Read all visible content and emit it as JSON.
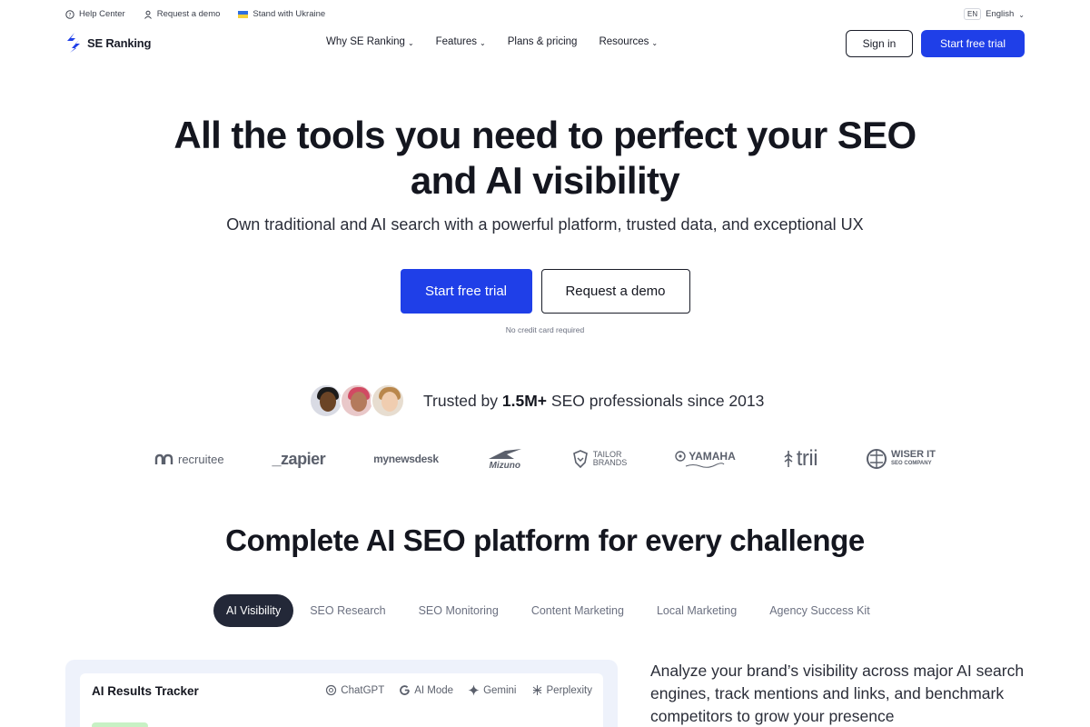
{
  "utility": {
    "help_center": "Help Center",
    "request_demo": "Request a demo",
    "ukraine": "Stand with Ukraine",
    "lang_code": "EN",
    "lang_label": "English"
  },
  "nav": {
    "brand": "SE Ranking",
    "links": [
      "Why SE Ranking",
      "Features",
      "Plans & pricing",
      "Resources"
    ],
    "sign_in": "Sign in",
    "start_trial": "Start free trial"
  },
  "hero": {
    "title_line1": "All the tools you need to perfect your SEO",
    "title_line2": "and AI visibility",
    "subtitle": "Own traditional and AI search with a powerful platform, trusted data, and exceptional UX",
    "primary_cta": "Start free trial",
    "secondary_cta": "Request a demo",
    "note": "No credit card required"
  },
  "trusted": {
    "prefix": "Trusted by",
    "count": "1.5M+",
    "suffix": "SEO professionals since 2013"
  },
  "logos": [
    "recruitee",
    "_zapier",
    "mynewsdesk",
    "Mizuno",
    "TAILOR",
    "BRANDS",
    "YAMAHA",
    "trii",
    "WISER IT",
    "SEO COMPANY"
  ],
  "section": {
    "title": "Complete AI SEO platform for every challenge",
    "tabs": [
      "AI Visibility",
      "SEO Research",
      "SEO Monitoring",
      "Content Marketing",
      "Local Marketing",
      "Agency Success Kit"
    ],
    "active_tab": "AI Visibility"
  },
  "card": {
    "title": "AI Results Tracker",
    "engines": [
      "ChatGPT",
      "AI Mode",
      "Gemini",
      "Perplexity"
    ]
  },
  "side_text": "Analyze your brand’s visibility across major AI search engines, track mentions and links, and benchmark competitors to grow your presence",
  "colors": {
    "accent": "#1f3fe8",
    "tab_active": "#232838",
    "card_bg": "#eef2fb"
  }
}
